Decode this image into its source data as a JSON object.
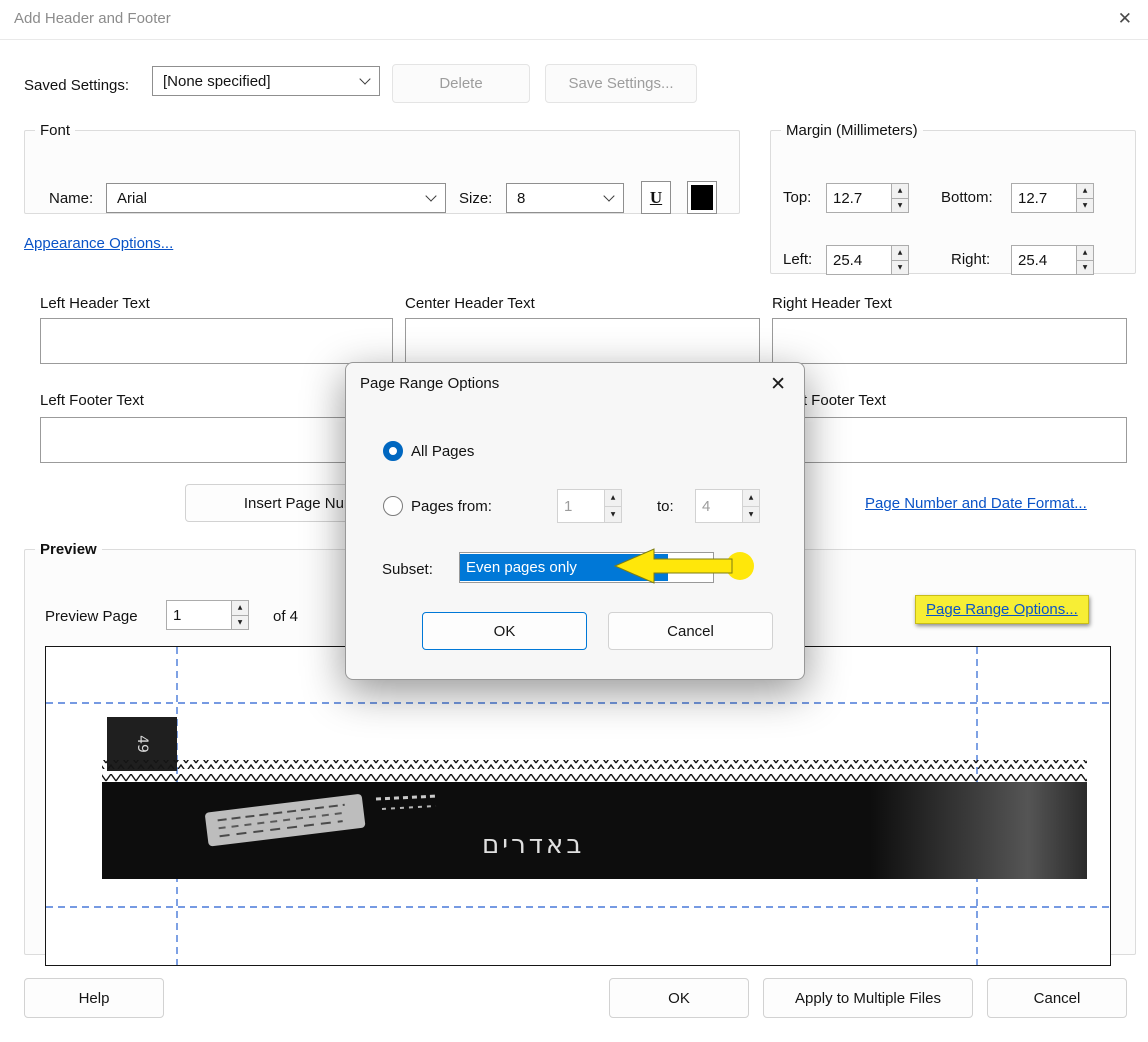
{
  "window": {
    "title": "Add Header and Footer",
    "close_glyph": "✕"
  },
  "saved_settings": {
    "label": "Saved Settings:",
    "value": "[None specified]",
    "delete_label": "Delete",
    "save_label": "Save Settings..."
  },
  "font": {
    "legend": "Font",
    "name_label": "Name:",
    "name_value": "Arial",
    "size_label": "Size:",
    "size_value": "8",
    "underline_glyph": "U"
  },
  "margin": {
    "legend": "Margin (Millimeters)",
    "top_label": "Top:",
    "top_value": "12.7",
    "bottom_label": "Bottom:",
    "bottom_value": "12.7",
    "left_label": "Left:",
    "left_value": "25.4",
    "right_label": "Right:",
    "right_value": "25.4"
  },
  "links": {
    "appearance": "Appearance Options...",
    "page_number_format": "Page Number and Date Format...",
    "page_range": "Page Range Options..."
  },
  "text_fields": {
    "left_header_label": "Left Header Text",
    "center_header_label": "Center Header Text",
    "right_header_label": "Right Header Text",
    "left_footer_label": "Left Footer Text",
    "right_footer_label": "Right Footer Text"
  },
  "insert_page_number_label": "Insert Page Number",
  "preview": {
    "legend": "Preview",
    "page_label": "Preview Page",
    "page_value": "1",
    "of_label": "of 4",
    "film_number": "49",
    "film_text": "באדרים"
  },
  "footer_buttons": {
    "help": "Help",
    "ok": "OK",
    "apply": "Apply to Multiple Files",
    "cancel": "Cancel"
  },
  "modal": {
    "title": "Page Range Options",
    "close_glyph": "✕",
    "all_pages_label": "All Pages",
    "pages_from_label": "Pages from:",
    "from_value": "1",
    "to_label": "to:",
    "to_value": "4",
    "subset_label": "Subset:",
    "subset_value": "Even pages only",
    "ok_label": "OK",
    "cancel_label": "Cancel"
  },
  "colors": {
    "link_blue": "#0a53c7",
    "selection_blue": "#0078d7",
    "radio_blue": "#0067c0",
    "guide_blue": "#4879d8",
    "highlight_yellow": "#f7ee35",
    "arrow_yellow": "#ffe70a"
  }
}
